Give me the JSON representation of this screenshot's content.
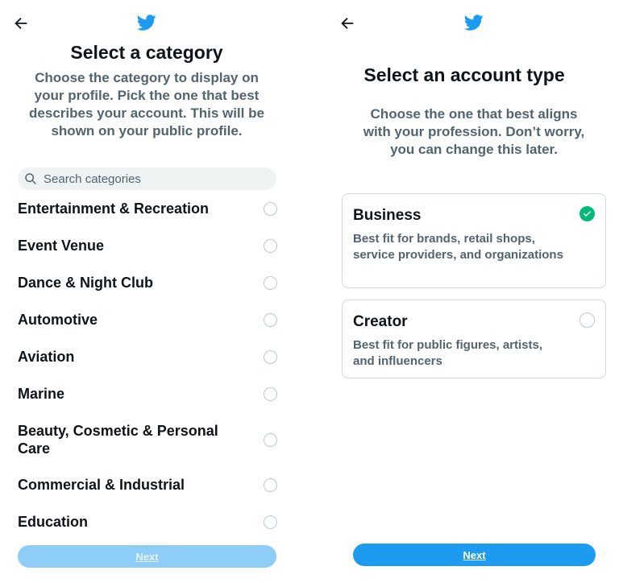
{
  "left": {
    "title": "Select a category",
    "subtitle": "Choose the category to display on your profile. Pick the one that best describes your account. This will be shown on your public profile.",
    "search_placeholder": "Search categories",
    "categories": [
      {
        "label": "Entertainment & Recreation",
        "selected": false
      },
      {
        "label": "Event Venue",
        "selected": false
      },
      {
        "label": "Dance & Night Club",
        "selected": false
      },
      {
        "label": "Automotive",
        "selected": false
      },
      {
        "label": "Aviation",
        "selected": false
      },
      {
        "label": "Marine",
        "selected": false
      },
      {
        "label": "Beauty, Cosmetic & Personal Care",
        "selected": false
      },
      {
        "label": "Commercial & Industrial",
        "selected": false
      },
      {
        "label": "Education",
        "selected": false
      }
    ],
    "next_label": "Next",
    "next_enabled": false
  },
  "right": {
    "title": "Select an account type",
    "subtitle": "Choose the one that best aligns with your profession. Don’t worry, you can change this later.",
    "options": [
      {
        "title": "Business",
        "description": "Best fit for brands, retail shops, service providers, and organizations",
        "selected": true
      },
      {
        "title": "Creator",
        "description": "Best fit for public figures, artists, and influencers",
        "selected": false
      }
    ],
    "next_label": "Next",
    "next_enabled": true
  },
  "colors": {
    "brand": "#1d9bf0",
    "brand_disabled": "#8ecdf7",
    "success": "#00ba7c",
    "text_primary": "#0f1419",
    "text_secondary": "#536471"
  },
  "icons": {
    "back": "back-arrow-icon",
    "logo": "twitter-bird-icon",
    "search": "search-icon",
    "selected": "checkmark-icon"
  }
}
